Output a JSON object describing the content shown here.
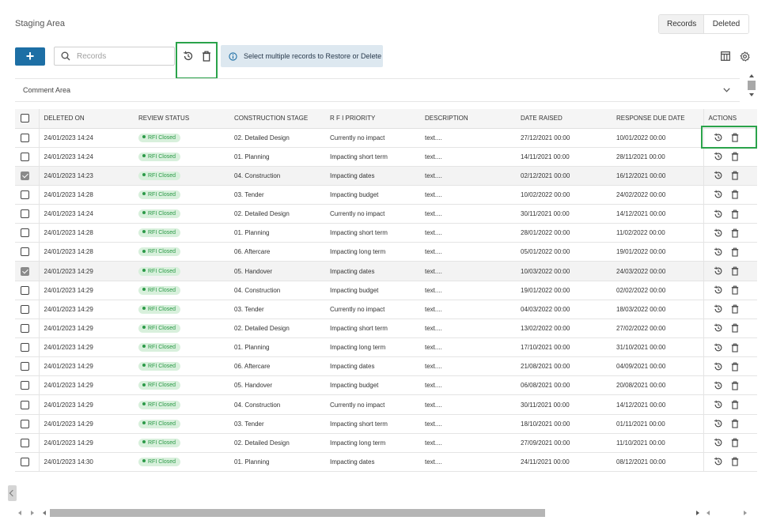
{
  "page": {
    "title": "Staging Area",
    "view_toggle": {
      "records_label": "Records",
      "deleted_label": "Deleted",
      "active": "Records"
    }
  },
  "toolbar": {
    "add_label": "+",
    "search_placeholder": "Records",
    "info_message": "Select multiple records to Restore or Delete",
    "icons": [
      "search-icon",
      "restore-icon",
      "trash-icon",
      "info-icon",
      "columns-icon",
      "gear-icon"
    ]
  },
  "comment_area": {
    "label": "Comment Area"
  },
  "table": {
    "columns": [
      "DELETED ON",
      "REVIEW STATUS",
      "CONSTRUCTION STAGE",
      "R F I PRIORITY",
      "DESCRIPTION",
      "DATE RAISED",
      "RESPONSE DUE DATE",
      "ACTIONS"
    ],
    "rows": [
      {
        "checked": false,
        "deleted_on": "24/01/2023 14:24",
        "status": "RFI Closed",
        "stage": "02. Detailed Design",
        "priority": "Currently no impact",
        "description": "text....",
        "date_raised": "27/12/2021 00:00",
        "due_date": "10/01/2022 00:00"
      },
      {
        "checked": false,
        "deleted_on": "24/01/2023 14:24",
        "status": "RFI Closed",
        "stage": "01. Planning",
        "priority": "Impacting short term",
        "description": "text....",
        "date_raised": "14/11/2021 00:00",
        "due_date": "28/11/2021 00:00"
      },
      {
        "checked": true,
        "deleted_on": "24/01/2023 14:23",
        "status": "RFI Closed",
        "stage": "04. Construction",
        "priority": "Impacting dates",
        "description": "text....",
        "date_raised": "02/12/2021 00:00",
        "due_date": "16/12/2021 00:00"
      },
      {
        "checked": false,
        "deleted_on": "24/01/2023 14:28",
        "status": "RFI Closed",
        "stage": "03. Tender",
        "priority": "Impacting budget",
        "description": "text....",
        "date_raised": "10/02/2022 00:00",
        "due_date": "24/02/2022 00:00"
      },
      {
        "checked": false,
        "deleted_on": "24/01/2023 14:24",
        "status": "RFI Closed",
        "stage": "02. Detailed Design",
        "priority": "Currently no impact",
        "description": "text....",
        "date_raised": "30/11/2021 00:00",
        "due_date": "14/12/2021 00:00"
      },
      {
        "checked": false,
        "deleted_on": "24/01/2023 14:28",
        "status": "RFI Closed",
        "stage": "01. Planning",
        "priority": "Impacting short term",
        "description": "text....",
        "date_raised": "28/01/2022 00:00",
        "due_date": "11/02/2022 00:00"
      },
      {
        "checked": false,
        "deleted_on": "24/01/2023 14:28",
        "status": "RFI Closed",
        "stage": "06. Aftercare",
        "priority": "Impacting long term",
        "description": "text....",
        "date_raised": "05/01/2022 00:00",
        "due_date": "19/01/2022 00:00"
      },
      {
        "checked": true,
        "deleted_on": "24/01/2023 14:29",
        "status": "RFI Closed",
        "stage": "05. Handover",
        "priority": "Impacting dates",
        "description": "text....",
        "date_raised": "10/03/2022 00:00",
        "due_date": "24/03/2022 00:00"
      },
      {
        "checked": false,
        "deleted_on": "24/01/2023 14:29",
        "status": "RFI Closed",
        "stage": "04. Construction",
        "priority": "Impacting budget",
        "description": "text....",
        "date_raised": "19/01/2022 00:00",
        "due_date": "02/02/2022 00:00"
      },
      {
        "checked": false,
        "deleted_on": "24/01/2023 14:29",
        "status": "RFI Closed",
        "stage": "03. Tender",
        "priority": "Currently no impact",
        "description": "text....",
        "date_raised": "04/03/2022 00:00",
        "due_date": "18/03/2022 00:00"
      },
      {
        "checked": false,
        "deleted_on": "24/01/2023 14:29",
        "status": "RFI Closed",
        "stage": "02. Detailed Design",
        "priority": "Impacting short term",
        "description": "text....",
        "date_raised": "13/02/2022 00:00",
        "due_date": "27/02/2022 00:00"
      },
      {
        "checked": false,
        "deleted_on": "24/01/2023 14:29",
        "status": "RFI Closed",
        "stage": "01. Planning",
        "priority": "Impacting long term",
        "description": "text....",
        "date_raised": "17/10/2021 00:00",
        "due_date": "31/10/2021 00:00"
      },
      {
        "checked": false,
        "deleted_on": "24/01/2023 14:29",
        "status": "RFI Closed",
        "stage": "06. Aftercare",
        "priority": "Impacting dates",
        "description": "text....",
        "date_raised": "21/08/2021 00:00",
        "due_date": "04/09/2021 00:00"
      },
      {
        "checked": false,
        "deleted_on": "24/01/2023 14:29",
        "status": "RFI Closed",
        "stage": "05. Handover",
        "priority": "Impacting budget",
        "description": "text....",
        "date_raised": "06/08/2021 00:00",
        "due_date": "20/08/2021 00:00"
      },
      {
        "checked": false,
        "deleted_on": "24/01/2023 14:29",
        "status": "RFI Closed",
        "stage": "04. Construction",
        "priority": "Currently no impact",
        "description": "text....",
        "date_raised": "30/11/2021 00:00",
        "due_date": "14/12/2021 00:00"
      },
      {
        "checked": false,
        "deleted_on": "24/01/2023 14:29",
        "status": "RFI Closed",
        "stage": "03. Tender",
        "priority": "Impacting short term",
        "description": "text....",
        "date_raised": "18/10/2021 00:00",
        "due_date": "01/11/2021 00:00"
      },
      {
        "checked": false,
        "deleted_on": "24/01/2023 14:29",
        "status": "RFI Closed",
        "stage": "02. Detailed Design",
        "priority": "Impacting long term",
        "description": "text....",
        "date_raised": "27/09/2021 00:00",
        "due_date": "11/10/2021 00:00"
      },
      {
        "checked": false,
        "deleted_on": "24/01/2023 14:30",
        "status": "RFI Closed",
        "stage": "01. Planning",
        "priority": "Impacting dates",
        "description": "text....",
        "date_raised": "24/11/2021 00:00",
        "due_date": "08/12/2021 00:00"
      }
    ]
  },
  "colors": {
    "primary": "#1d6fa5",
    "highlight": "#2aa34a",
    "badge_bg": "#d8f0dc",
    "badge_text": "#2c9a48",
    "info_bg": "#dde8f0"
  }
}
